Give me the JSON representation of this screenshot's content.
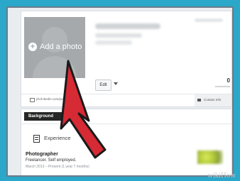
{
  "profile": {
    "add_photo_label": "Add a photo",
    "edit_label": "Edit",
    "connections_count": "0",
    "connections_label": "connections",
    "public_url": "ph.linkedin.com/pub/",
    "contact_info_label": "Contact Info"
  },
  "sections": {
    "background_tab": "Background",
    "experience_heading": "Experience"
  },
  "experience": {
    "title": "Photographer",
    "organization": "Freelancer. Self employed.",
    "dates": "March 2013 – Present (1 year 7 months)"
  },
  "watermark": "wikiHow",
  "colors": {
    "backdrop": "#2aa7c9",
    "cursor_fill": "#d62a35",
    "tab_background": "#262626",
    "photo_placeholder": "#a5a9ac"
  },
  "icons": [
    "plus-icon",
    "chevron-down-icon",
    "link-icon",
    "contact-card-icon",
    "briefcase-icon",
    "mouse-pointer-icon"
  ]
}
